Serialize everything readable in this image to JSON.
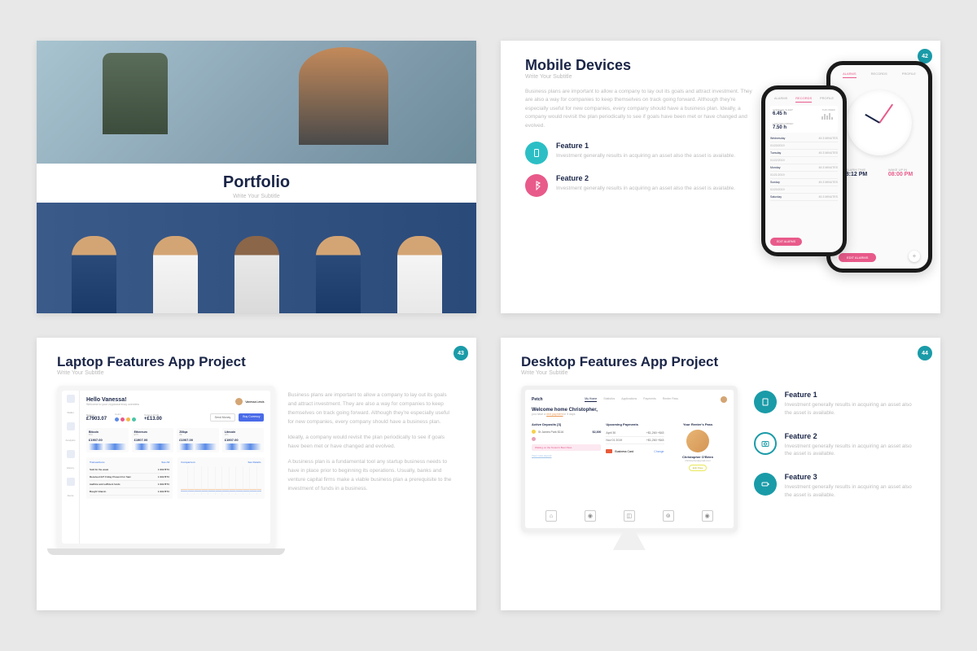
{
  "slide1": {
    "title": "Portfolio",
    "subtitle": "Write Your Subtitle"
  },
  "slide2": {
    "page": "42",
    "title": "Mobile Devices",
    "subtitle": "Write Your Subtitle",
    "body": "Business plans are important to allow a company to lay out its goals and attract investment. They are also a way for companies to keep themselves on track going forward. Although they're especially useful for new companies, every company should have a business plan. Ideally, a company would revisit the plan periodically to see if goals have been met or have changed and evolved.",
    "feat1_title": "Feature 1",
    "feat1_body": "Investment generally results in acquiring an asset also the asset is available.",
    "feat2_title": "Feature 2",
    "feat2_body": "Investment generally results in acquiring an asset also the asset is available.",
    "phone1": {
      "tab1": "ALARMS",
      "tab2": "RECORDS",
      "tab3": "PROFILE",
      "avg_lbl": "AVERAGE SLEEP",
      "avg_val": "6.45 h",
      "week_lbl": "THIS WEEK",
      "last_lbl": "LAST RECORDED",
      "last_val": "7.50 h",
      "rows": [
        {
          "day": "Wednesday",
          "date": "01/23/2019",
          "dur": "49.3 MINUTES"
        },
        {
          "day": "Tuesday",
          "date": "01/22/2019",
          "dur": "49.3 MINUTES"
        },
        {
          "day": "Monday",
          "date": "01/21/2019",
          "dur": "49.3 MINUTES"
        },
        {
          "day": "Sunday",
          "date": "01/20/2019",
          "dur": "49.3 MINUTES"
        },
        {
          "day": "Saturday",
          "date": "01/19/2019",
          "dur": "49.3 MINUTES"
        }
      ],
      "btn": "EDIT ALARMS"
    },
    "phone2": {
      "tab1": "ALARMS",
      "tab2": "RECORDS",
      "tab3": "PROFILE",
      "alarm_lbl": "ALARM TIME",
      "alarm_val": "8:12 PM",
      "wake_lbl": "WAKE UP IN",
      "wake_val": "08:00 PM",
      "btn": "EDIT ALARMS",
      "plus": "+"
    }
  },
  "slide3": {
    "page": "43",
    "title": "Laptop Features App Project",
    "subtitle": "Write Your Subtitle",
    "laptop": {
      "side": {
        "s1": "Wallet",
        "s2": "Analytics",
        "s3": "History",
        "s4": "Alerts",
        "s5": "Logout"
      },
      "hello": "Hello Vanessa!",
      "welcome": "Welcome to your cryptocurrency overview",
      "user": "Vanessa Lewis",
      "balance_lbl": "Balance",
      "balance_val": "£7903.07",
      "coins_lbl": "Coins",
      "profit_lbl": "Today's Profit",
      "profit_val": "+£13.00",
      "btn1": "Send Money",
      "btn2": "Buy Currency",
      "cards": [
        {
          "nm": "Bitcoin",
          "cd": "BTC",
          "pr": "£1907.00"
        },
        {
          "nm": "Ethereum",
          "cd": "ETH",
          "pr": "£1907.00"
        },
        {
          "nm": "Zilliqa",
          "cd": "ZIL",
          "pr": "£1907.00"
        },
        {
          "nm": "Litecoin",
          "cd": "LTC",
          "pr": "£1907.00"
        }
      ],
      "trans_title": "Transactions",
      "trans_link": "See All",
      "trans": [
        {
          "t": "Sold for the week",
          "a": "1.902 BTC"
        },
        {
          "t": "Received 227 Friday Present For Sam",
          "a": "1.902 BTC"
        },
        {
          "t": "Aadhira sold sufficient funds",
          "a": "1.902 BTC"
        },
        {
          "t": "Bought Vitamin",
          "a": "1.902 BTC"
        }
      ],
      "comp_title": "Comparison",
      "comp_link": "See Details"
    },
    "para1": "Business plans are important to allow a company to lay out its goals and attract investment. They are also a way for companies to keep themselves on track going forward. Although they're especially useful for new companies, every company should have a business plan.",
    "para2": "Ideally, a company would revisit the plan periodically to see if goals have been met or have changed and evolved.",
    "para3": "A business plan is a fundamental tool any startup business needs to have in place prior to beginning its operations. Usually, banks and venture capital firms make a viable business plan a prerequisite to the investment of funds in a business."
  },
  "slide4": {
    "page": "44",
    "title": "Desktop Features App Project",
    "subtitle": "Write Your Subtitle",
    "desktop": {
      "logo": "Petch",
      "tabs": {
        "t1": "My Home",
        "t2": "Statistics",
        "t3": "Applications",
        "t4": "Payments",
        "t5": "Renter Pass"
      },
      "wel_h": "Welcome home Christopher,",
      "wel_p1": "you have a ",
      "wel_hl": "rent payment",
      "wel_p2": " in 5 days",
      "col1_h": "Active Deposits [3]",
      "dep1": "St James Park $116",
      "dep1_amt": "$2,300",
      "dep2_tag": "Waiting on the Tenant's Best Pass",
      "meta": "View meta deposit",
      "col2_h": "Upcoming Payments",
      "up1_d": "April 30",
      "up1_a": "+$1,260 +$43",
      "up2_d": "Nov 01 2019",
      "up2_a": "+$1,260 +$43",
      "card_lbl": "Business Card",
      "card_link": "Change",
      "col3_h": "Your Renter's Pass",
      "rent_nm": "Christopher O'Brien",
      "rent_em": "christopher@gmail.com",
      "rent_tag": "Edit Pass"
    },
    "feat1_title": "Feature 1",
    "feat1_body": "Investment generally results in acquiring an asset also the asset is available.",
    "feat2_title": "Feature 2",
    "feat2_body": "Investment generally results in acquiring an asset also the asset is available.",
    "feat3_title": "Feature 3",
    "feat3_body": "Investment generally results in acquiring an asset also the asset is available."
  }
}
